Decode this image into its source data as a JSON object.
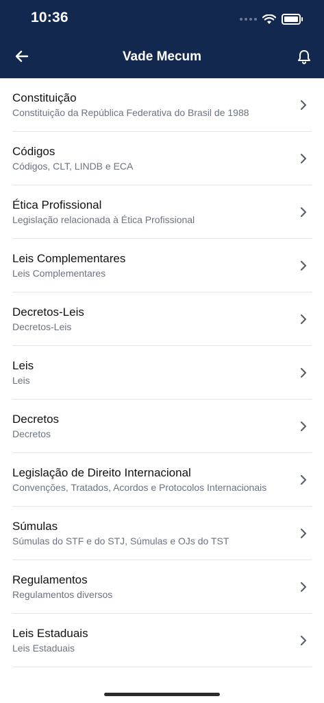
{
  "status_bar": {
    "time": "10:36"
  },
  "nav": {
    "title": "Vade Mecum"
  },
  "items": [
    {
      "title": "Constituição",
      "subtitle": "Constituição da República Federativa do Brasil de 1988"
    },
    {
      "title": "Códigos",
      "subtitle": "Códigos, CLT, LINDB e ECA"
    },
    {
      "title": "Ética Profissional",
      "subtitle": "Legislação relacionada à Ética Profissional"
    },
    {
      "title": "Leis Complementares",
      "subtitle": "Leis Complementares"
    },
    {
      "title": "Decretos-Leis",
      "subtitle": "Decretos-Leis"
    },
    {
      "title": "Leis",
      "subtitle": "Leis"
    },
    {
      "title": "Decretos",
      "subtitle": "Decretos"
    },
    {
      "title": "Legislação de Direito Internacional",
      "subtitle": "Convenções, Tratados, Acordos e Protocolos Internacionais"
    },
    {
      "title": "Súmulas",
      "subtitle": "Súmulas do STF e do STJ, Súmulas e OJs do TST"
    },
    {
      "title": "Regulamentos",
      "subtitle": "Regulamentos diversos"
    },
    {
      "title": "Leis Estaduais",
      "subtitle": "Leis Estaduais"
    }
  ],
  "colors": {
    "header_bg": "#13284f",
    "subtitle": "#6a7380",
    "divider": "#e2e4e8"
  },
  "icons": {
    "back": "arrow-left-icon",
    "notifications": "bell-icon",
    "row": "chevron-right-icon"
  }
}
